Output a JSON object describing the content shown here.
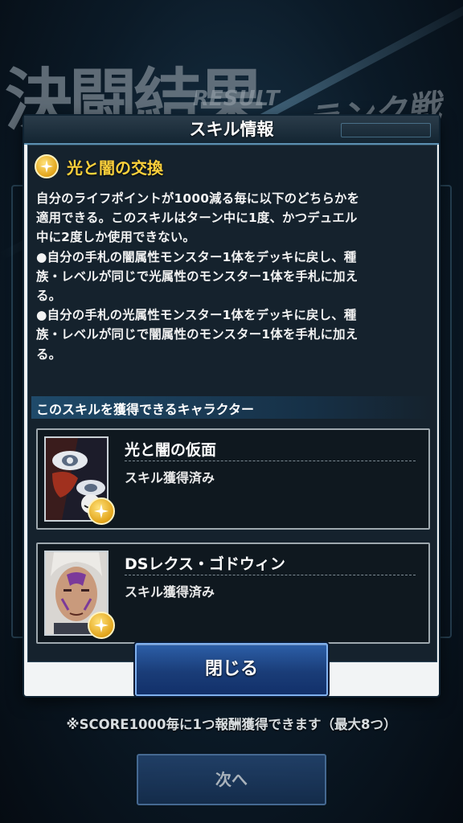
{
  "background": {
    "title_kanji": "決闘結果",
    "title_sub": "RESULT",
    "mode_label": "ランク戦"
  },
  "modal": {
    "title": "スキル情報",
    "skill": {
      "name": "光と闇の交換",
      "icon": "star-icon",
      "description": "自分のライフポイントが1000減る毎に以下のどちらかを\n適用できる。このスキルはターン中に1度、かつデュエル\n中に2度しか使用できない。\n●自分の手札の闇属性モンスター1体をデッキに戻し、種\n族・レベルが同じで光属性のモンスター1体を手札に加え\nる。\n●自分の手札の光属性モンスター1体をデッキに戻し、種\n族・レベルが同じで闇属性のモンスター1体を手札に加え\nる。"
    },
    "characters_header": "このスキルを獲得できるキャラクター",
    "characters": [
      {
        "name": "光と闇の仮面",
        "status": "スキル獲得済み",
        "icon": "star-icon"
      },
      {
        "name": "DSレクス・ゴドウィン",
        "status": "スキル獲得済み",
        "icon": "star-icon"
      }
    ],
    "close_label": "閉じる"
  },
  "footer": {
    "note": "※SCORE1000毎に1つ報酬獲得できます（最大8つ）",
    "next_label": "次へ"
  },
  "colors": {
    "skill_name": "#ffd23c",
    "button_blue": "#1a3d78",
    "badge_gold": "#e2a41a"
  }
}
